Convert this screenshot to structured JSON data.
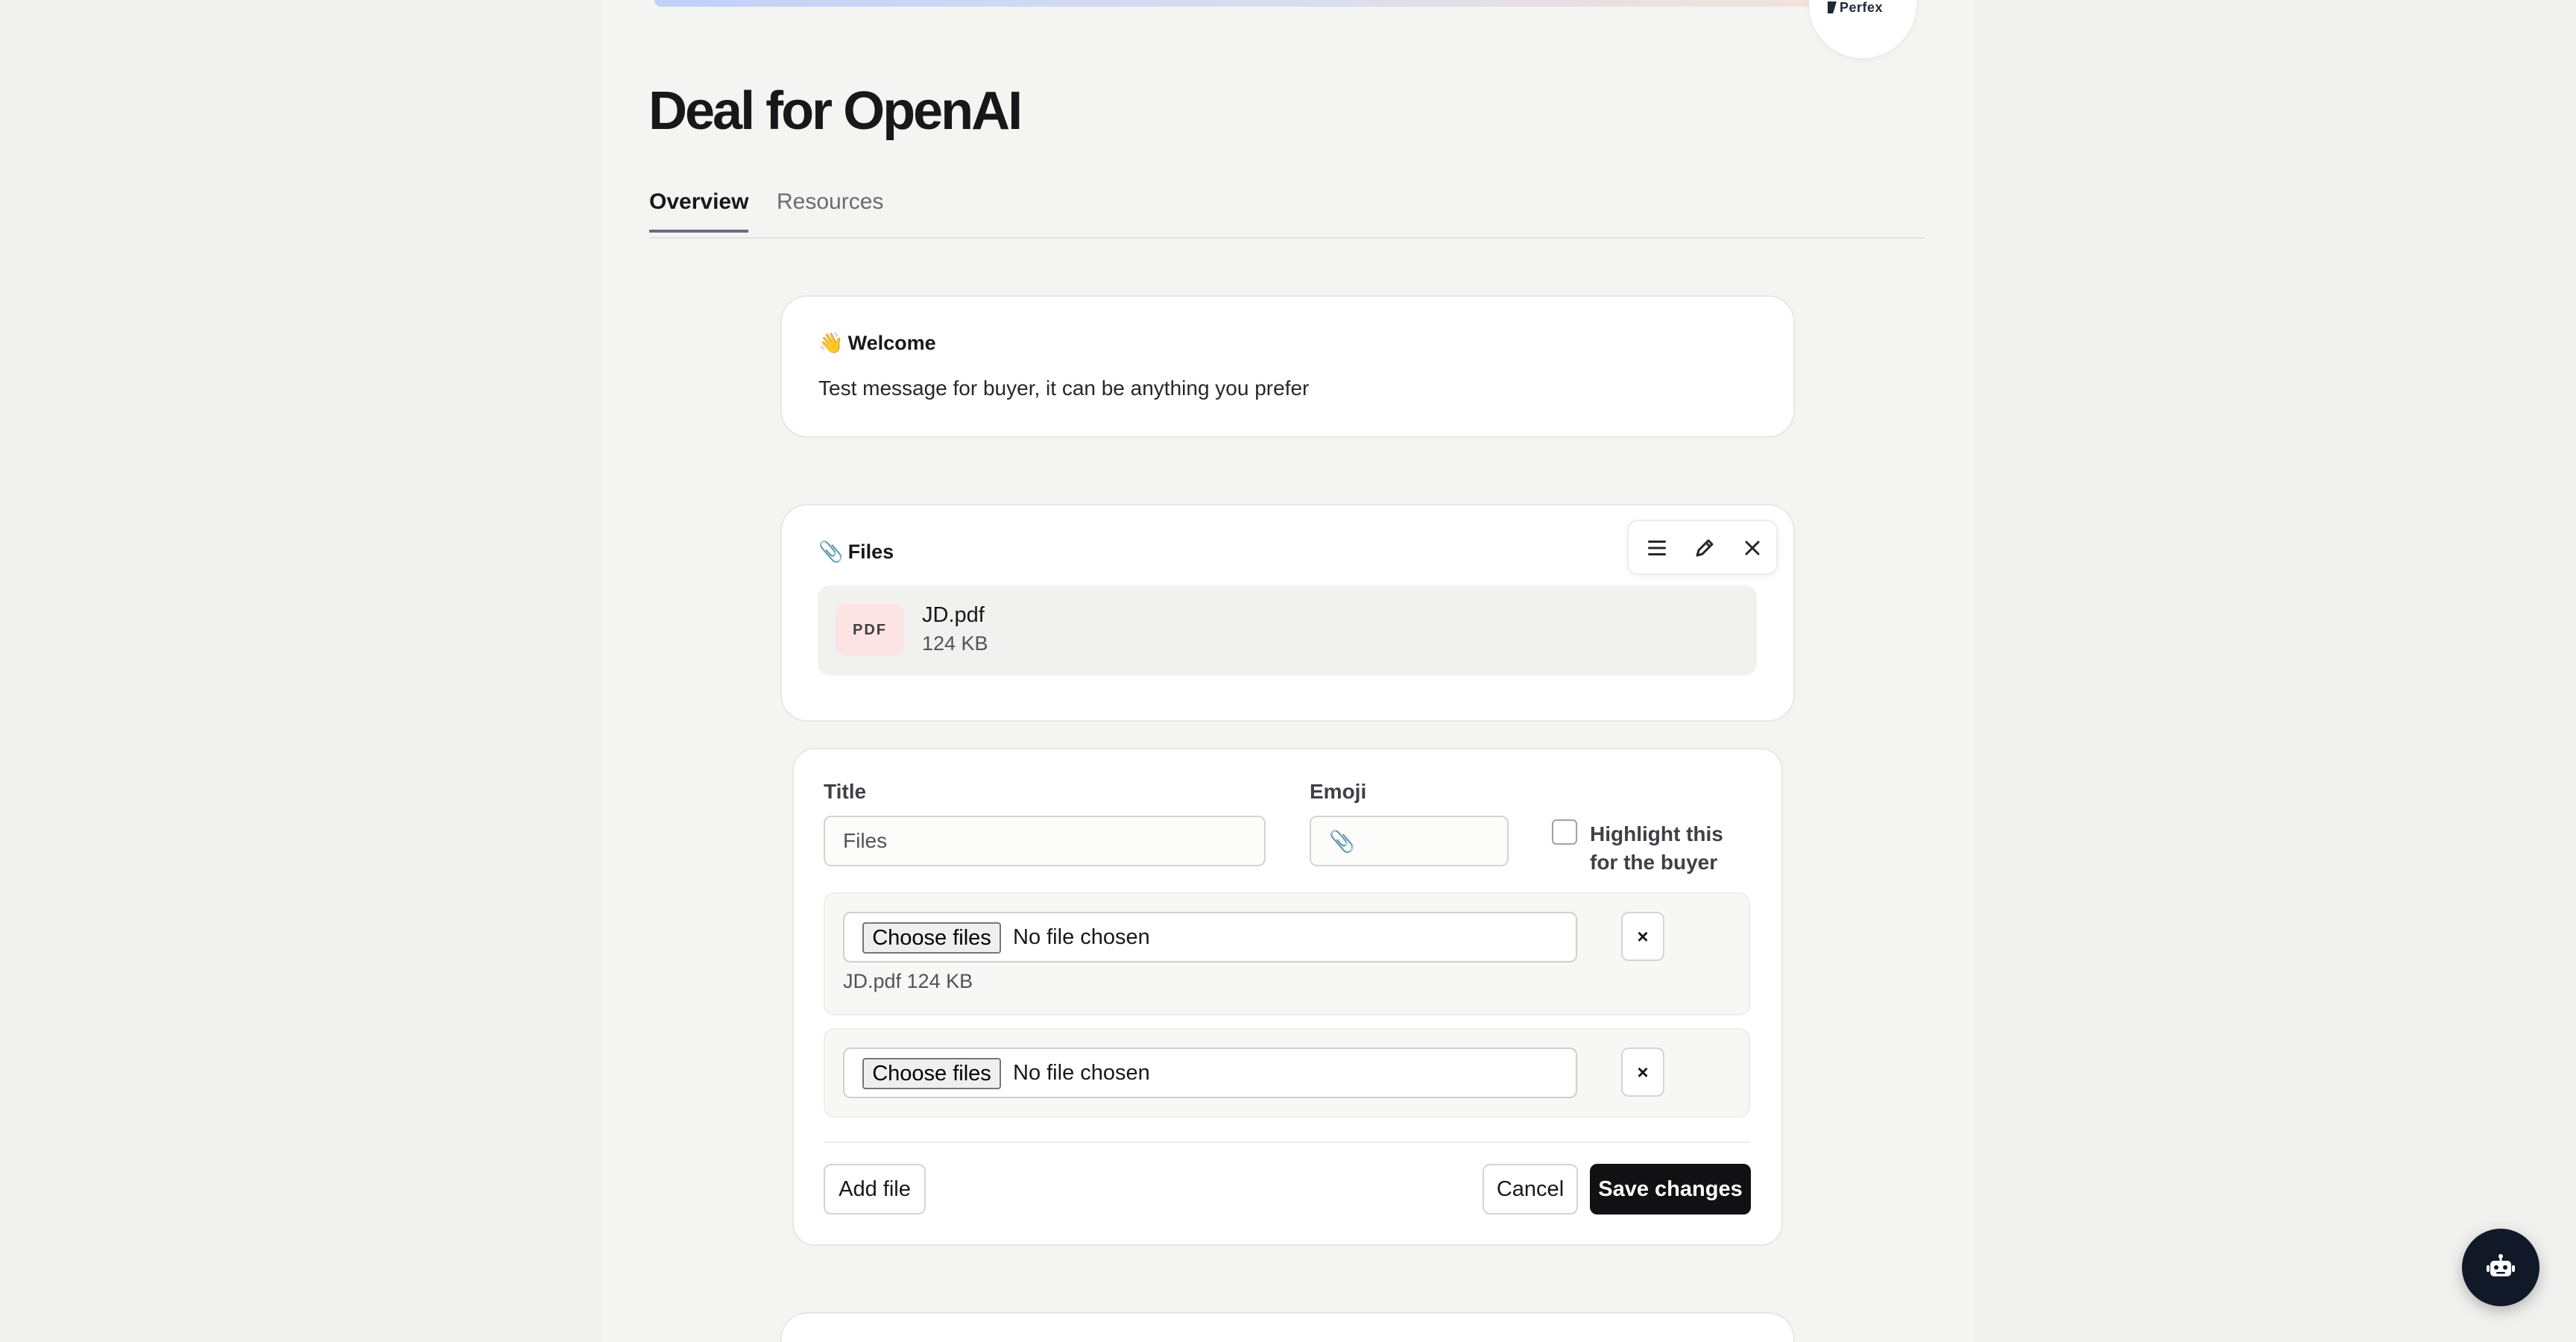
{
  "brand": {
    "logo_text": "Perfex"
  },
  "page": {
    "title": "Deal for OpenAI"
  },
  "tabs": [
    {
      "label": "Overview",
      "active": true
    },
    {
      "label": "Resources",
      "active": false
    }
  ],
  "welcome_card": {
    "emoji": "👋",
    "title": "Welcome",
    "message": "Test message for buyer, it can be anything you prefer"
  },
  "files_card": {
    "emoji": "📎",
    "title": "Files",
    "toolbar": {
      "icons": [
        "drag-handle-icon",
        "pencil-icon",
        "close-icon"
      ]
    },
    "files": [
      {
        "type_badge": "PDF",
        "name": "JD.pdf",
        "size": "124 KB"
      }
    ]
  },
  "edit_form": {
    "title_label": "Title",
    "title_value": "Files",
    "emoji_label": "Emoji",
    "emoji_value": "📎",
    "highlight_label": "Highlight this for the buyer",
    "highlight_checked": false,
    "uploads": [
      {
        "choose_label": "Choose files",
        "status": "No file chosen",
        "existing": "JD.pdf 124 KB"
      },
      {
        "choose_label": "Choose files",
        "status": "No file chosen",
        "existing": ""
      }
    ],
    "remove_label": "×",
    "add_file_label": "Add file",
    "cancel_label": "Cancel",
    "save_label": "Save changes"
  },
  "fab": {
    "icon": "bot-icon"
  }
}
